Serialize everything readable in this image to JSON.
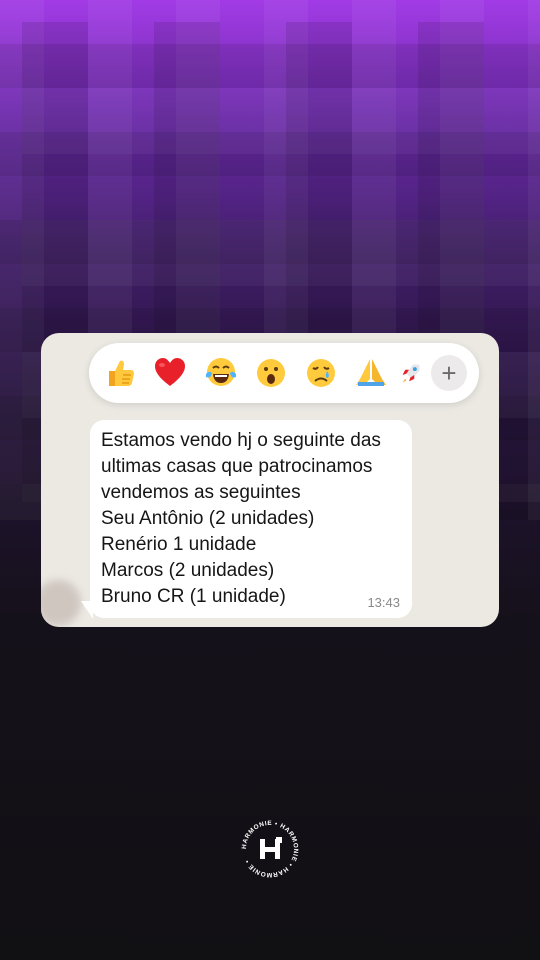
{
  "reactions": {
    "items": [
      {
        "name": "thumbs-up-icon"
      },
      {
        "name": "red-heart-icon"
      },
      {
        "name": "tears-of-joy-icon"
      },
      {
        "name": "surprised-face-icon"
      },
      {
        "name": "crying-face-icon"
      },
      {
        "name": "folded-hands-icon"
      },
      {
        "name": "rocket-icon"
      }
    ],
    "more_label": "+"
  },
  "message": {
    "lines": [
      "Estamos vendo hj o seguinte das",
      "ultimas casas que patrocinamos",
      "vendemos as  seguintes",
      "Seu Antônio (2 unidades)",
      "Renério 1 unidade",
      "Marcos (2 unidades)",
      "Bruno CR (1 unidade)"
    ],
    "time": "13:43"
  },
  "brand": {
    "ring_text": "HARMONIE • HARMONIE • HARMONIE •",
    "colors": {
      "accent_top": "#a23be6",
      "background_bottom": "#111013"
    }
  }
}
